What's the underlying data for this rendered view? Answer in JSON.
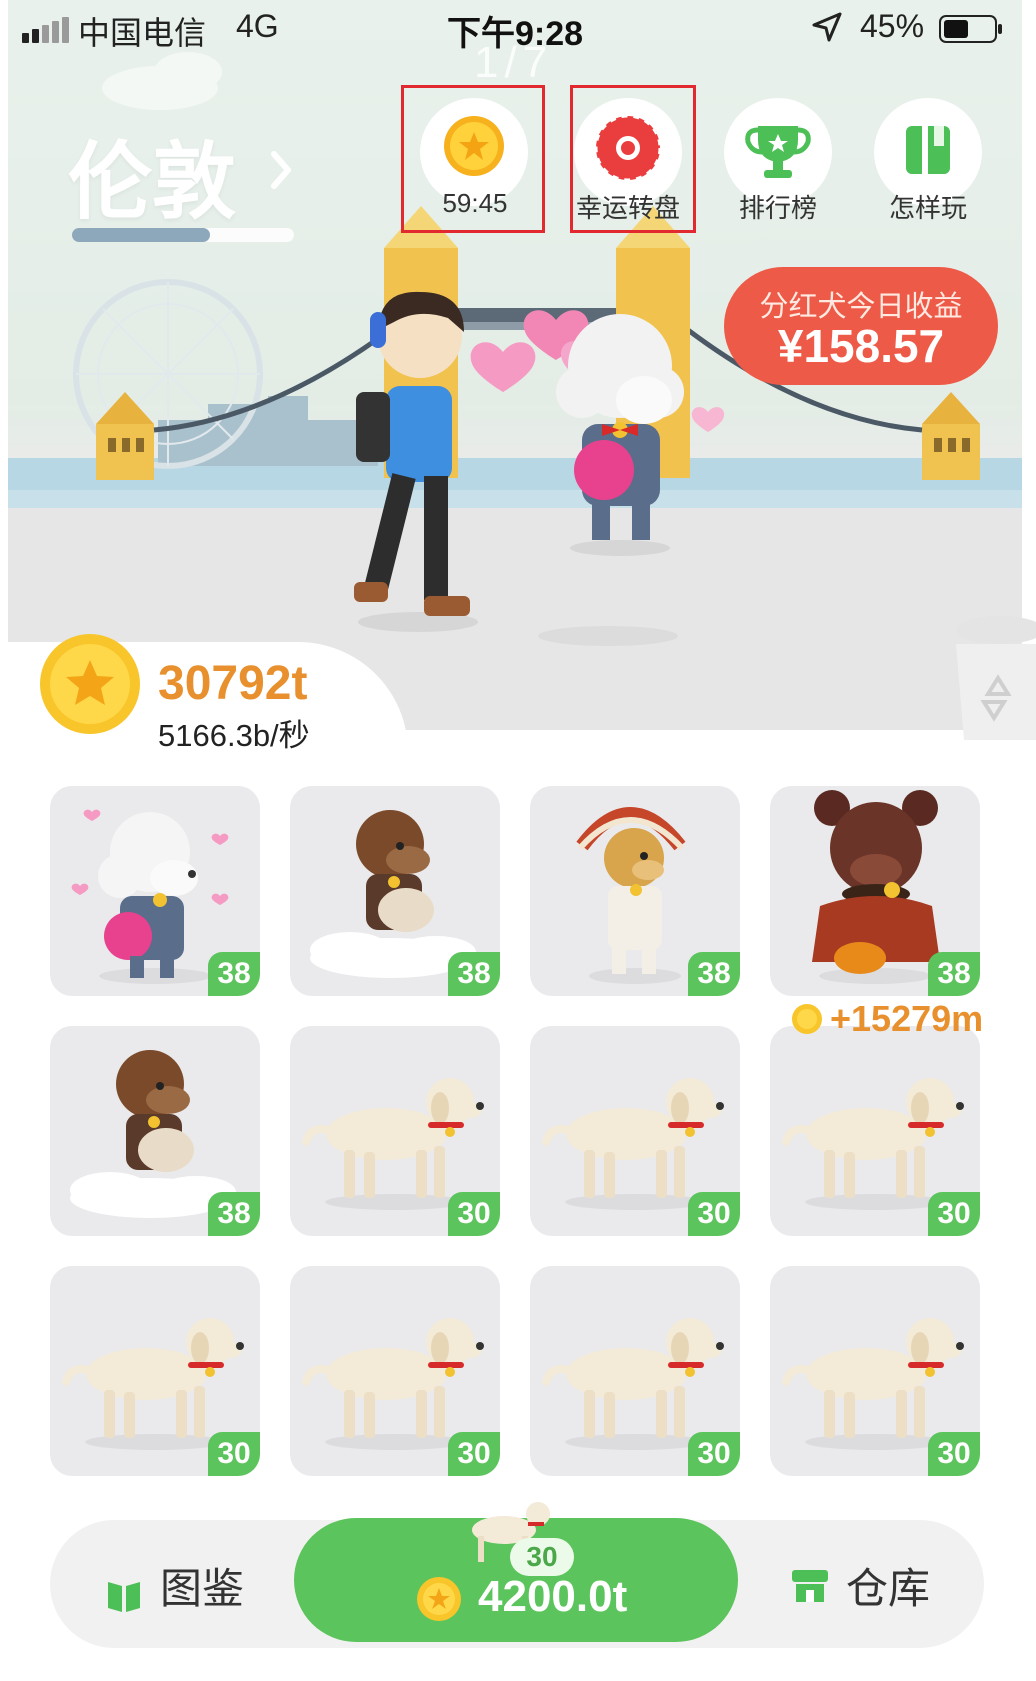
{
  "status_bar": {
    "carrier": "中国电信",
    "network": "4G",
    "time": "下午9:28",
    "battery_percent": "45%"
  },
  "page_indicator": "1/7",
  "city": {
    "name": "伦敦",
    "unlock_progress": 0.62
  },
  "top_buttons": [
    {
      "id": "coin-timer",
      "label": "59:45",
      "highlighted": true
    },
    {
      "id": "lucky-wheel",
      "label": "幸运转盘",
      "highlighted": true
    },
    {
      "id": "leaderboard",
      "label": "排行榜",
      "highlighted": false
    },
    {
      "id": "how-to-play",
      "label": "怎样玩",
      "highlighted": false
    }
  ],
  "dividend_dog": {
    "title": "分红犬今日收益",
    "amount": "¥158.57"
  },
  "coins": {
    "total": "30792t",
    "rate": "5166.3b/秒"
  },
  "grid": [
    {
      "dog": "poodle",
      "level": "38"
    },
    {
      "dog": "cloud-rider",
      "level": "38"
    },
    {
      "dog": "chief",
      "level": "38"
    },
    {
      "dog": "bear",
      "level": "38"
    },
    {
      "dog": "cloud-rider",
      "level": "38"
    },
    {
      "dog": "labrador",
      "level": "30"
    },
    {
      "dog": "labrador",
      "level": "30"
    },
    {
      "dog": "labrador",
      "level": "30"
    },
    {
      "dog": "labrador",
      "level": "30"
    },
    {
      "dog": "labrador",
      "level": "30"
    },
    {
      "dog": "labrador",
      "level": "30"
    },
    {
      "dog": "labrador",
      "level": "30"
    }
  ],
  "earn_popup": "+15279m",
  "bottom": {
    "collection_label": "图鉴",
    "warehouse_label": "仓库",
    "buy_level": "30",
    "buy_price": "4200.0t"
  },
  "colors": {
    "green": "#5cc45c",
    "red_banner": "#ee5a48",
    "coin_orange": "#e8902d",
    "highlight_red": "#e2292f"
  }
}
